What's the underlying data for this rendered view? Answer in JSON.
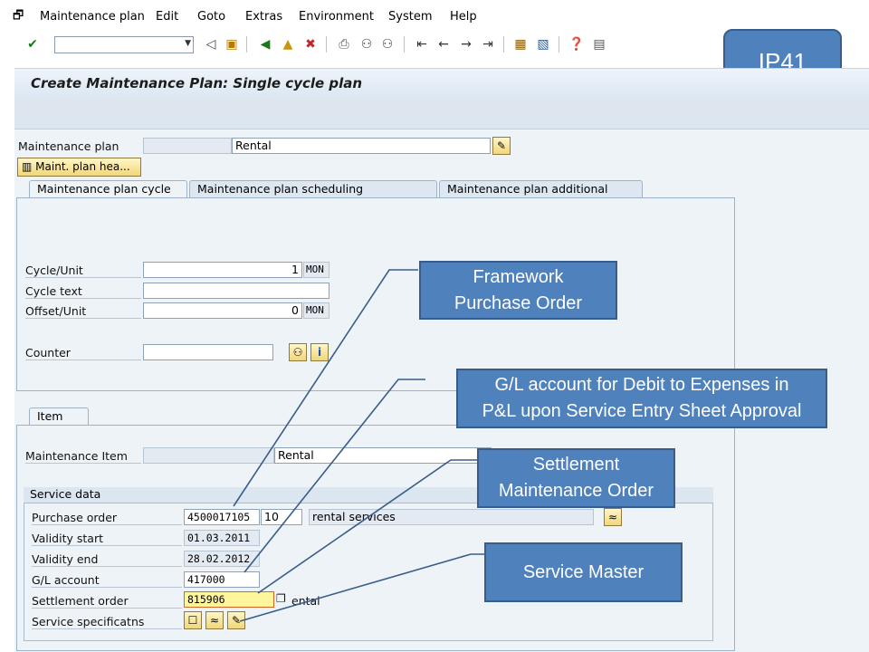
{
  "menu": {
    "items": [
      {
        "label": "Maintenance plan"
      },
      {
        "label": "Edit"
      },
      {
        "label": "Goto"
      },
      {
        "label": "Extras"
      },
      {
        "label": "Environment"
      },
      {
        "label": "System"
      },
      {
        "label": "Help"
      }
    ]
  },
  "toolbar": {
    "command_field_value": "",
    "icons": [
      "enter-check-icon",
      "back-icon",
      "save-icon",
      "back-green-icon",
      "exit-icon",
      "cancel-icon",
      "print-icon",
      "find-icon",
      "find-next-icon",
      "first-page-icon",
      "previous-page-icon",
      "next-page-icon",
      "last-page-icon",
      "create-session-icon",
      "shortcut-icon",
      "help-icon",
      "customize-layout-icon"
    ]
  },
  "title": "Create Maintenance Plan: Single cycle plan",
  "header": {
    "plan_label": "Maintenance plan",
    "plan_number": "",
    "plan_text": "Rental",
    "header_button_label": "Maint. plan hea..."
  },
  "tabs": [
    {
      "label": "Maintenance plan cycle",
      "active": true
    },
    {
      "label": "Maintenance plan scheduling parameters",
      "active": false
    },
    {
      "label": "Maintenance plan additional data",
      "active": false
    }
  ],
  "cycle": {
    "cycle_unit_label": "Cycle/Unit",
    "cycle_value": "1",
    "cycle_unit": "MON",
    "cycle_text_label": "Cycle text",
    "cycle_text_value": "",
    "offset_label": "Offset/Unit",
    "offset_value": "0",
    "offset_unit": "MON",
    "counter_label": "Counter",
    "counter_value": ""
  },
  "item_tab": {
    "label": "Item"
  },
  "item": {
    "maintenance_item_label": "Maintenance Item",
    "maintenance_item_number": "",
    "maintenance_item_text": "Rental"
  },
  "service_data": {
    "title": "Service data",
    "purchase_order_label": "Purchase order",
    "purchase_order_value": "4500017105",
    "po_item_value": "10",
    "po_text_value": "rental services",
    "validity_start_label": "Validity start",
    "validity_start_value": "01.03.2011",
    "validity_end_label": "Validity end",
    "validity_end_value": "28.02.2012",
    "gl_account_label": "G/L account",
    "gl_account_value": "417000",
    "settlement_order_label": "Settlement order",
    "settlement_order_value": "815906",
    "settlement_order_text": "ental",
    "service_spec_label": "Service specificatns"
  },
  "annotations": {
    "tcode": "IP41",
    "framework_po": "Framework Purchase Order",
    "framework_po_line1": "Framework",
    "framework_po_line2": "Purchase Order",
    "gl_line1": "G/L account for Debit to Expenses in",
    "gl_line2": "P&L upon Service Entry Sheet Approval",
    "settlement_line1": "Settlement",
    "settlement_line2": "Maintenance Order",
    "service_master": "Service Master"
  },
  "colors": {
    "callout_fill": "#4f81bd",
    "callout_border": "#385d8a",
    "highlight_field": "#fff59d"
  }
}
